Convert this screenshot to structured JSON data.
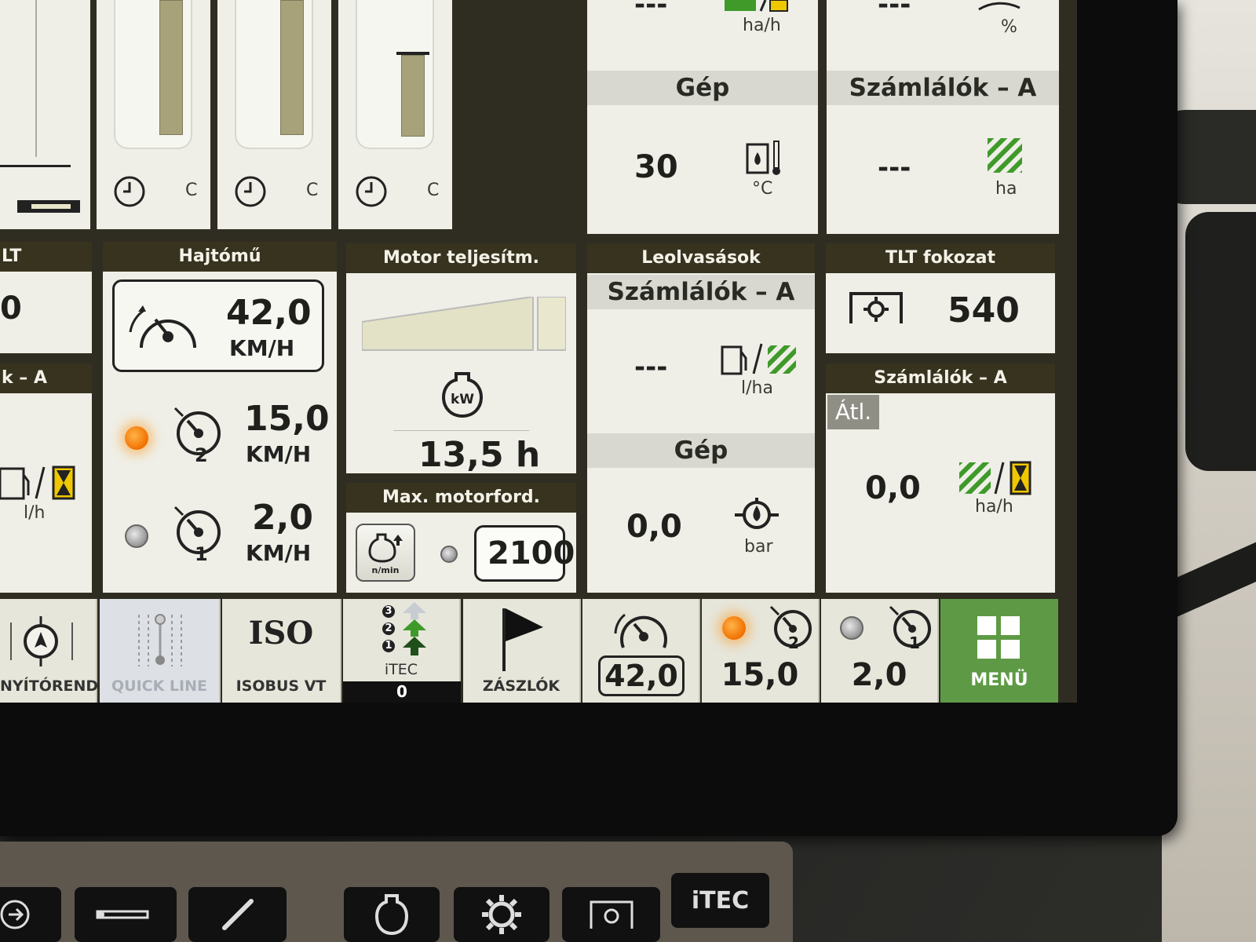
{
  "gauges": {
    "unit_c": "C"
  },
  "top_right": {
    "top_unit_a": "ha/h",
    "top_value_a": "---",
    "top_unit_b": "%",
    "top_value_b": "---",
    "gep": {
      "title": "Gép",
      "value": "30",
      "unit": "°C"
    },
    "szamlalok": {
      "title": "Számlálók – A",
      "value": "---",
      "unit": "ha"
    }
  },
  "left_cut": {
    "header_top": "LT",
    "value_top": "0",
    "header_mid": "k – A",
    "unit": "l/h"
  },
  "hajtomu": {
    "header": "Hajtómű",
    "main_value": "42,0",
    "main_unit": "KM/H",
    "row2_value": "15,0",
    "row2_unit": "KM/H",
    "row2_badge": "2",
    "row1_value": "2,0",
    "row1_unit": "KM/H",
    "row1_badge": "1"
  },
  "motor": {
    "header": "Motor teljesítm.",
    "icon_label": "kW",
    "hours": "13,5 h",
    "load_fraction": 0.9
  },
  "max_motor": {
    "header": "Max. motorford.",
    "icon_label": "n/min",
    "value": "2100"
  },
  "leolvasasok": {
    "header": "Leolvasások",
    "sub": "Számlálók – A",
    "value": "---",
    "unit": "l/ha",
    "gep_title": "Gép",
    "gep_value": "0,0",
    "gep_unit": "bar"
  },
  "tlt": {
    "header": "TLT fokozat",
    "value": "540"
  },
  "szamlalok_a": {
    "header": "Számlálók – A",
    "badge": "Átl.",
    "value": "0,0",
    "unit": "ha/h"
  },
  "bottom_bar": {
    "kormany": "NYÍTÓREND",
    "quickline": "QUICK LINE",
    "isobus_logo": "ISO",
    "isobus": "ISOBUS VT",
    "itec": "iTEC",
    "itec_count": "0",
    "itec_steps": [
      "3",
      "2",
      "1"
    ],
    "zaszlok": "ZÁSZLÓK",
    "speed_main": "42,0",
    "speed_2": "15,0",
    "speed_2_badge": "2",
    "speed_1": "2,0",
    "speed_1_badge": "1",
    "menu": "MENÜ"
  },
  "keyboard": {
    "itec_key": "iTEC"
  },
  "colors": {
    "header_bg": "#37331f",
    "panel_bg": "#efefe7",
    "menu_green": "#5e9a45",
    "indicator_orange": "#f07000",
    "stripe_green": "#3f9a2a",
    "hourglass_yellow": "#f0c800"
  }
}
